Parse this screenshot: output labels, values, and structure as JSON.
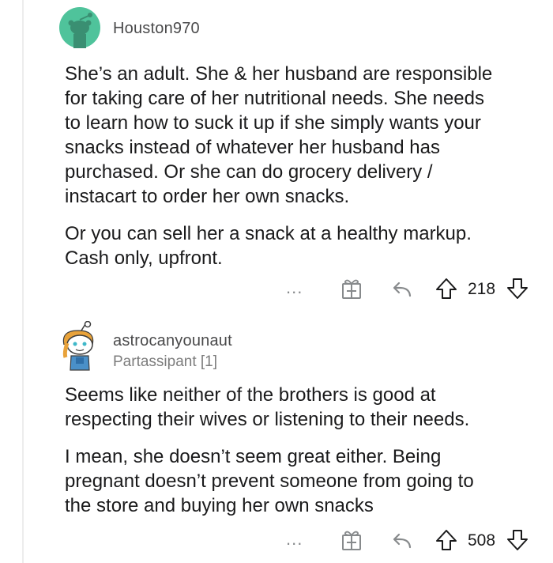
{
  "comments": [
    {
      "username": "Houston970",
      "flair": "",
      "paragraphs": [
        "She’s an adult.  She & her husband are responsible\nfor taking care of her nutritional needs.  She needs\nto learn how to suck it up if she simply wants your\nsnacks instead of whatever her husband has\npurchased.  Or she can do grocery delivery /\ninstacart to order her own snacks.",
        "Or you can sell her a snack at a healthy markup.\nCash only, upfront."
      ],
      "more_label": "...",
      "score": "218",
      "avatar_color": "#4fc39b"
    },
    {
      "username": "astrocanyounaut",
      "flair": "Partassipant [1]",
      "paragraphs": [
        "Seems like neither of the brothers is good at\nrespecting their wives or listening to their needs.",
        "I mean, she doesn’t seem great either. Being\npregnant doesn’t prevent someone from going to\nthe store and buying her own snacks"
      ],
      "more_label": "...",
      "score": "508",
      "avatar_color": "#e8a23a"
    }
  ],
  "icons": {
    "award": "gift-award-icon",
    "reply": "reply-arrow-icon",
    "upvote": "upvote-arrow-icon",
    "downvote": "downvote-arrow-icon"
  }
}
